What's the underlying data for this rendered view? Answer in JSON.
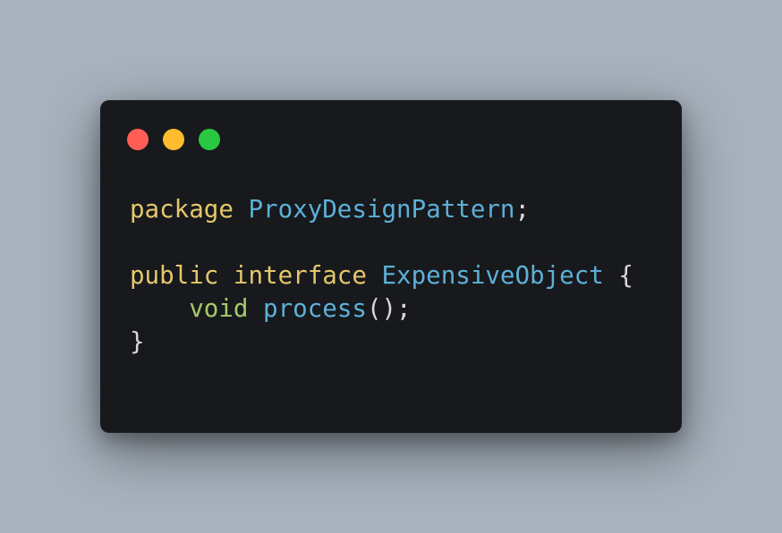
{
  "window": {
    "controls": {
      "close_color": "#ff5f57",
      "minimize_color": "#febc2e",
      "maximize_color": "#28c840"
    }
  },
  "code": {
    "line1": {
      "keyword": "package",
      "name": "ProxyDesignPattern",
      "end": ";"
    },
    "line3": {
      "keyword1": "public",
      "keyword2": "interface",
      "name": "ExpensiveObject",
      "brace": "{"
    },
    "line4": {
      "indent": "    ",
      "type": "void",
      "method": "process",
      "end": "();"
    },
    "line5": {
      "brace": "}"
    }
  },
  "colors": {
    "background": "#a7b2bd",
    "editor": "#17191c",
    "keyword": "#e5c76b",
    "type": "#a6c96a",
    "identifier": "#5db0d7",
    "punctuation": "#d8d8d8"
  }
}
